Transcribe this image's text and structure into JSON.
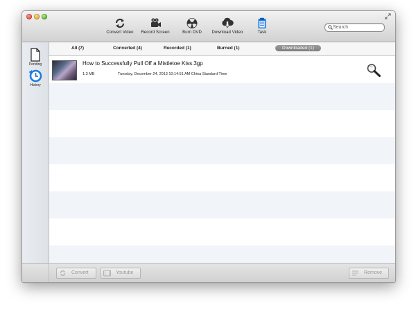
{
  "toolbar": {
    "items": [
      {
        "label": "Convert Video",
        "icon": "refresh-arrows-icon"
      },
      {
        "label": "Record Screen",
        "icon": "video-camera-icon"
      },
      {
        "label": "Burn DVD",
        "icon": "radiation-disc-icon"
      },
      {
        "label": "Download Video",
        "icon": "cloud-download-icon"
      },
      {
        "label": "Task",
        "icon": "clipboard-icon"
      }
    ],
    "search_placeholder": "Search"
  },
  "sidebar": {
    "items": [
      {
        "label": "Pending",
        "icon": "document-icon"
      },
      {
        "label": "History",
        "icon": "history-clock-icon"
      }
    ]
  },
  "tabs": [
    {
      "label": "All (7)"
    },
    {
      "label": "Converted (4)"
    },
    {
      "label": "Recorded (1)"
    },
    {
      "label": "Burned (1)"
    },
    {
      "label": "Downloaded (1)",
      "active": true
    }
  ],
  "list": {
    "rows": [
      {
        "title": "How to Successfully Pull Off a Mistletoe Kiss.3gp",
        "size": "1.3 MB",
        "date": "Tuesday, December 24, 2013 10:14:51 AM China Standard Time"
      }
    ]
  },
  "bottombar": {
    "convert_label": "Convert",
    "youtube_label": "Youtube",
    "remove_label": "Remove"
  },
  "colors": {
    "accent": "#1f7be0",
    "active_tab": "#8a8a8a",
    "row_stripe": "#f1f4f9"
  }
}
